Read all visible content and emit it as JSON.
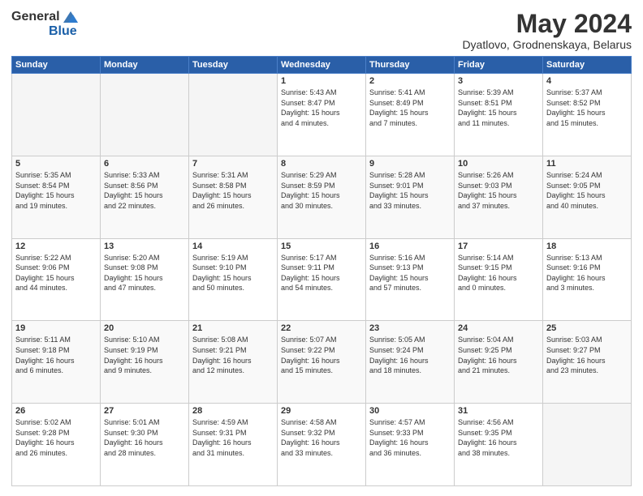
{
  "logo": {
    "general": "General",
    "blue": "Blue"
  },
  "title": "May 2024",
  "location": "Dyatlovo, Grodnenskaya, Belarus",
  "weekdays": [
    "Sunday",
    "Monday",
    "Tuesday",
    "Wednesday",
    "Thursday",
    "Friday",
    "Saturday"
  ],
  "weeks": [
    [
      {
        "day": "",
        "info": ""
      },
      {
        "day": "",
        "info": ""
      },
      {
        "day": "",
        "info": ""
      },
      {
        "day": "1",
        "info": "Sunrise: 5:43 AM\nSunset: 8:47 PM\nDaylight: 15 hours\nand 4 minutes."
      },
      {
        "day": "2",
        "info": "Sunrise: 5:41 AM\nSunset: 8:49 PM\nDaylight: 15 hours\nand 7 minutes."
      },
      {
        "day": "3",
        "info": "Sunrise: 5:39 AM\nSunset: 8:51 PM\nDaylight: 15 hours\nand 11 minutes."
      },
      {
        "day": "4",
        "info": "Sunrise: 5:37 AM\nSunset: 8:52 PM\nDaylight: 15 hours\nand 15 minutes."
      }
    ],
    [
      {
        "day": "5",
        "info": "Sunrise: 5:35 AM\nSunset: 8:54 PM\nDaylight: 15 hours\nand 19 minutes."
      },
      {
        "day": "6",
        "info": "Sunrise: 5:33 AM\nSunset: 8:56 PM\nDaylight: 15 hours\nand 22 minutes."
      },
      {
        "day": "7",
        "info": "Sunrise: 5:31 AM\nSunset: 8:58 PM\nDaylight: 15 hours\nand 26 minutes."
      },
      {
        "day": "8",
        "info": "Sunrise: 5:29 AM\nSunset: 8:59 PM\nDaylight: 15 hours\nand 30 minutes."
      },
      {
        "day": "9",
        "info": "Sunrise: 5:28 AM\nSunset: 9:01 PM\nDaylight: 15 hours\nand 33 minutes."
      },
      {
        "day": "10",
        "info": "Sunrise: 5:26 AM\nSunset: 9:03 PM\nDaylight: 15 hours\nand 37 minutes."
      },
      {
        "day": "11",
        "info": "Sunrise: 5:24 AM\nSunset: 9:05 PM\nDaylight: 15 hours\nand 40 minutes."
      }
    ],
    [
      {
        "day": "12",
        "info": "Sunrise: 5:22 AM\nSunset: 9:06 PM\nDaylight: 15 hours\nand 44 minutes."
      },
      {
        "day": "13",
        "info": "Sunrise: 5:20 AM\nSunset: 9:08 PM\nDaylight: 15 hours\nand 47 minutes."
      },
      {
        "day": "14",
        "info": "Sunrise: 5:19 AM\nSunset: 9:10 PM\nDaylight: 15 hours\nand 50 minutes."
      },
      {
        "day": "15",
        "info": "Sunrise: 5:17 AM\nSunset: 9:11 PM\nDaylight: 15 hours\nand 54 minutes."
      },
      {
        "day": "16",
        "info": "Sunrise: 5:16 AM\nSunset: 9:13 PM\nDaylight: 15 hours\nand 57 minutes."
      },
      {
        "day": "17",
        "info": "Sunrise: 5:14 AM\nSunset: 9:15 PM\nDaylight: 16 hours\nand 0 minutes."
      },
      {
        "day": "18",
        "info": "Sunrise: 5:13 AM\nSunset: 9:16 PM\nDaylight: 16 hours\nand 3 minutes."
      }
    ],
    [
      {
        "day": "19",
        "info": "Sunrise: 5:11 AM\nSunset: 9:18 PM\nDaylight: 16 hours\nand 6 minutes."
      },
      {
        "day": "20",
        "info": "Sunrise: 5:10 AM\nSunset: 9:19 PM\nDaylight: 16 hours\nand 9 minutes."
      },
      {
        "day": "21",
        "info": "Sunrise: 5:08 AM\nSunset: 9:21 PM\nDaylight: 16 hours\nand 12 minutes."
      },
      {
        "day": "22",
        "info": "Sunrise: 5:07 AM\nSunset: 9:22 PM\nDaylight: 16 hours\nand 15 minutes."
      },
      {
        "day": "23",
        "info": "Sunrise: 5:05 AM\nSunset: 9:24 PM\nDaylight: 16 hours\nand 18 minutes."
      },
      {
        "day": "24",
        "info": "Sunrise: 5:04 AM\nSunset: 9:25 PM\nDaylight: 16 hours\nand 21 minutes."
      },
      {
        "day": "25",
        "info": "Sunrise: 5:03 AM\nSunset: 9:27 PM\nDaylight: 16 hours\nand 23 minutes."
      }
    ],
    [
      {
        "day": "26",
        "info": "Sunrise: 5:02 AM\nSunset: 9:28 PM\nDaylight: 16 hours\nand 26 minutes."
      },
      {
        "day": "27",
        "info": "Sunrise: 5:01 AM\nSunset: 9:30 PM\nDaylight: 16 hours\nand 28 minutes."
      },
      {
        "day": "28",
        "info": "Sunrise: 4:59 AM\nSunset: 9:31 PM\nDaylight: 16 hours\nand 31 minutes."
      },
      {
        "day": "29",
        "info": "Sunrise: 4:58 AM\nSunset: 9:32 PM\nDaylight: 16 hours\nand 33 minutes."
      },
      {
        "day": "30",
        "info": "Sunrise: 4:57 AM\nSunset: 9:33 PM\nDaylight: 16 hours\nand 36 minutes."
      },
      {
        "day": "31",
        "info": "Sunrise: 4:56 AM\nSunset: 9:35 PM\nDaylight: 16 hours\nand 38 minutes."
      },
      {
        "day": "",
        "info": ""
      }
    ]
  ]
}
